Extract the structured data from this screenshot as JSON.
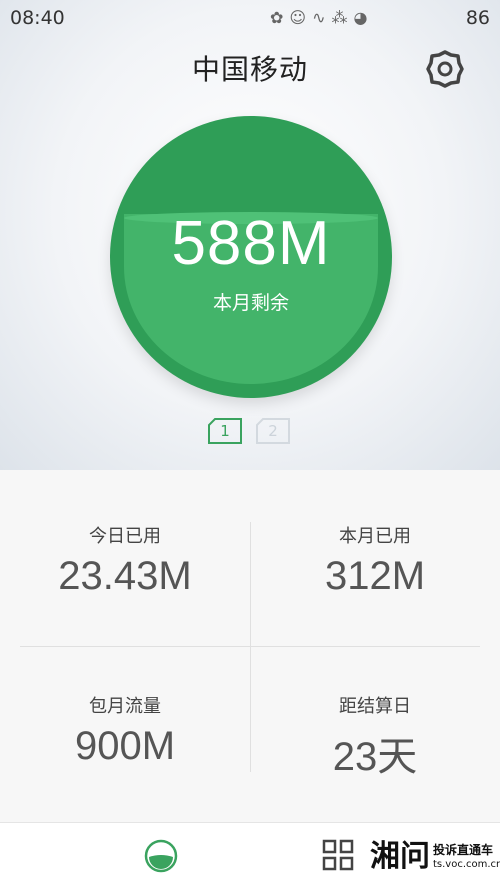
{
  "status_bar": {
    "time": "08:40",
    "battery": "86",
    "icons": [
      "flower-icon",
      "owl-icon",
      "bird-icon",
      "chain-icon",
      "totoro-icon"
    ]
  },
  "header": {
    "title": "中国移动",
    "settings_icon": "gear-icon"
  },
  "gauge": {
    "value": "588M",
    "label": "本月剩余",
    "remaining_fraction": 0.65,
    "colors": {
      "outer": "#2f9e57",
      "inner": "#43b46a"
    }
  },
  "sim_tabs": [
    {
      "label": "1",
      "active": true
    },
    {
      "label": "2",
      "active": false
    }
  ],
  "stats": {
    "today_used": {
      "label": "今日已用",
      "value": "23.43M"
    },
    "month_used": {
      "label": "本月已用",
      "value": "312M"
    },
    "package": {
      "label": "包月流量",
      "value": "900M"
    },
    "days_to_billing": {
      "label": "距结算日",
      "value": "23天"
    }
  },
  "bottom_nav": {
    "items": [
      {
        "icon": "gauge-icon",
        "active": true
      },
      {
        "icon": "grid-icon",
        "active": false
      }
    ]
  },
  "watermark": {
    "logo": "湘问",
    "text": "投诉直通车",
    "url": "ts.voc.com.cn"
  },
  "colors": {
    "accent": "#3aa35f"
  }
}
